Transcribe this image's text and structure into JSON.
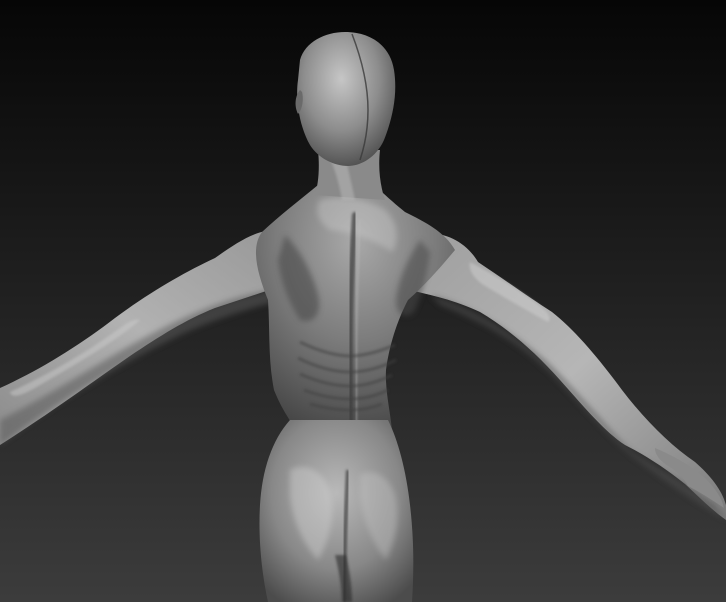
{
  "viewport": {
    "background_top": "#060606",
    "background_bottom": "#3c3c3c",
    "model_base_color": "#7a7a7a",
    "model_highlight_color": "#c4c4c4",
    "model_shadow_color": "#2e2e2e",
    "model": {
      "subject": "humanoid-figure",
      "view": "back",
      "material": "matcap-grey"
    }
  }
}
